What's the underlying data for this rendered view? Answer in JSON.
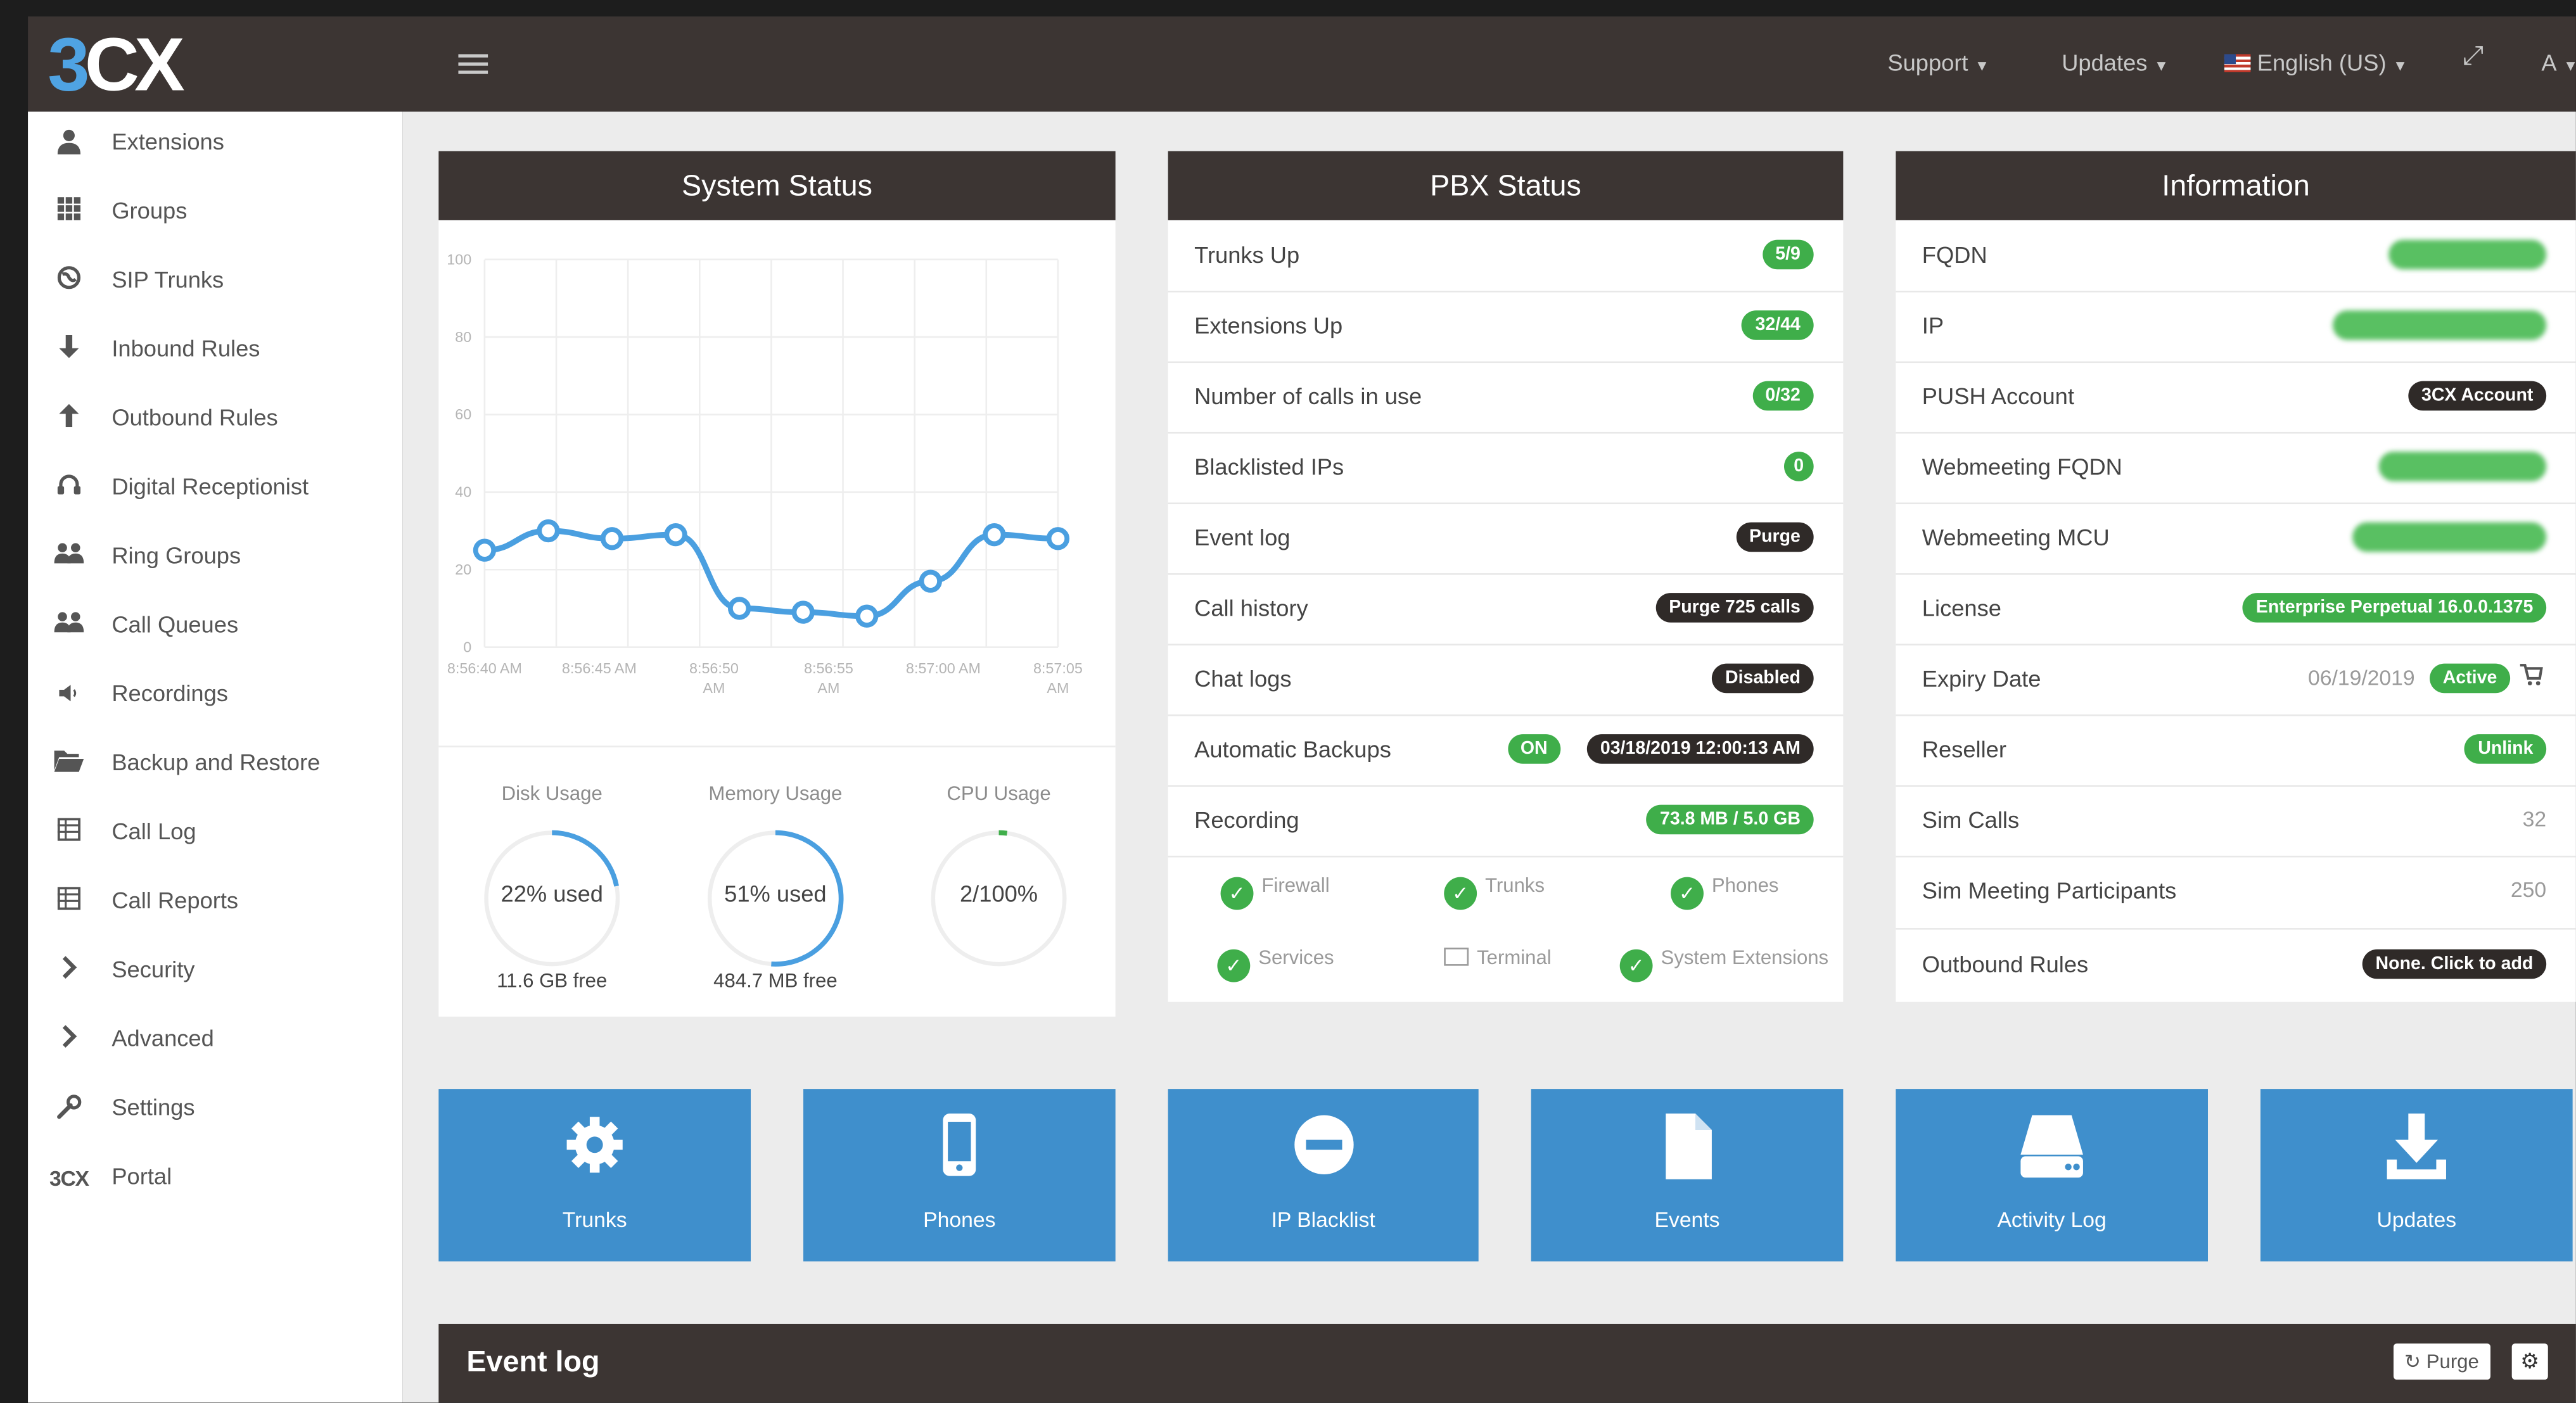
{
  "brand": {
    "logo_3": "3",
    "logo_cx": "CX"
  },
  "topnav": {
    "support": "Support",
    "updates": "Updates",
    "language": "English (US)",
    "user_initial": "A"
  },
  "sidebar": {
    "items": [
      {
        "label": "Extensions",
        "icon": "user-icon"
      },
      {
        "label": "Groups",
        "icon": "grid-icon"
      },
      {
        "label": "SIP Trunks",
        "icon": "globe-icon"
      },
      {
        "label": "Inbound Rules",
        "icon": "arrow-down-icon"
      },
      {
        "label": "Outbound Rules",
        "icon": "arrow-up-icon"
      },
      {
        "label": "Digital Receptionist",
        "icon": "headset-icon"
      },
      {
        "label": "Ring Groups",
        "icon": "users-icon"
      },
      {
        "label": "Call Queues",
        "icon": "users-icon"
      },
      {
        "label": "Recordings",
        "icon": "speaker-icon"
      },
      {
        "label": "Backup and Restore",
        "icon": "folder-icon"
      },
      {
        "label": "Call Log",
        "icon": "table-icon"
      },
      {
        "label": "Call Reports",
        "icon": "table-icon"
      },
      {
        "label": "Security",
        "icon": "chevron-right-icon"
      },
      {
        "label": "Advanced",
        "icon": "chevron-right-icon"
      },
      {
        "label": "Settings",
        "icon": "wrench-icon"
      },
      {
        "label": "Portal",
        "icon": "3cx-icon",
        "icon_text": "3CX"
      }
    ]
  },
  "system_status": {
    "title": "System Status",
    "chart_data": {
      "type": "line",
      "title": "",
      "xlabel": "",
      "ylabel": "",
      "ylim": [
        0,
        100
      ],
      "yticks": [
        "100",
        "80",
        "60",
        "40",
        "20",
        "0"
      ],
      "xticks": [
        "8:56:40 AM",
        "8:56:45 AM",
        "8:56:50 AM",
        "8:56:55 AM",
        "8:57:00 AM",
        "8:57:05 AM"
      ],
      "values": [
        25,
        30,
        28,
        29,
        10,
        9,
        8,
        17,
        29,
        28
      ],
      "line_color": "#4a9fe0",
      "grid": true
    },
    "gauges": [
      {
        "label": "Disk Usage",
        "text": "22% used",
        "sub": "11.6 GB free",
        "value": 22
      },
      {
        "label": "Memory Usage",
        "text": "51% used",
        "sub": "484.7 MB free",
        "value": 51
      },
      {
        "label": "CPU Usage",
        "text": "2/100%",
        "sub": "",
        "value": 2
      }
    ]
  },
  "pbx_status": {
    "title": "PBX Status",
    "rows": [
      {
        "label": "Trunks Up",
        "badge": "5/9"
      },
      {
        "label": "Extensions Up",
        "badge": "32/44"
      },
      {
        "label": "Number of calls in use",
        "badge": "0/32"
      },
      {
        "label": "Blacklisted IPs",
        "badge": "0"
      },
      {
        "label": "Event log",
        "badge": "Purge"
      },
      {
        "label": "Call history",
        "badge": "Purge 725 calls"
      },
      {
        "label": "Chat logs",
        "badge": "Disabled"
      },
      {
        "label": "Automatic Backups",
        "badge_on": "ON",
        "badge": "03/18/2019 12:00:13 AM"
      },
      {
        "label": "Recording",
        "badge": "73.8 MB / 5.0 GB"
      }
    ],
    "services": [
      {
        "label": "Firewall",
        "status": "ok"
      },
      {
        "label": "Trunks",
        "status": "ok"
      },
      {
        "label": "Phones",
        "status": "ok"
      },
      {
        "label": "Services",
        "status": "ok"
      },
      {
        "label": "Terminal",
        "status": "terminal"
      },
      {
        "label": "System Extensions",
        "status": "ok"
      }
    ]
  },
  "information": {
    "title": "Information",
    "rows": [
      {
        "label": "FQDN"
      },
      {
        "label": "IP"
      },
      {
        "label": "PUSH Account",
        "badge": "3CX Account"
      },
      {
        "label": "Webmeeting FQDN"
      },
      {
        "label": "Webmeeting MCU"
      },
      {
        "label": "License",
        "badge": "Enterprise Perpetual 16.0.0.1375"
      },
      {
        "label": "Expiry Date",
        "value": "06/19/2019",
        "badge": "Active"
      },
      {
        "label": "Reseller",
        "badge": "Unlink"
      },
      {
        "label": "Sim Calls",
        "value": "32"
      },
      {
        "label": "Sim Meeting Participants",
        "value": "250"
      },
      {
        "label": "Outbound Rules",
        "badge": "None. Click to add"
      }
    ]
  },
  "tiles": [
    {
      "label": "Trunks",
      "icon": "gear-icon"
    },
    {
      "label": "Phones",
      "icon": "phone-icon"
    },
    {
      "label": "IP Blacklist",
      "icon": "minus-circle-icon"
    },
    {
      "label": "Events",
      "icon": "file-icon"
    },
    {
      "label": "Activity Log",
      "icon": "drive-icon"
    },
    {
      "label": "Updates",
      "icon": "download-icon"
    }
  ],
  "event_log": {
    "title": "Event log",
    "purge_label": "Purge"
  },
  "colors": {
    "topbar": "#3c3533",
    "accent_blue": "#3f8fcc",
    "badge_green": "#3fae4a",
    "badge_dark": "#2f2a28"
  }
}
